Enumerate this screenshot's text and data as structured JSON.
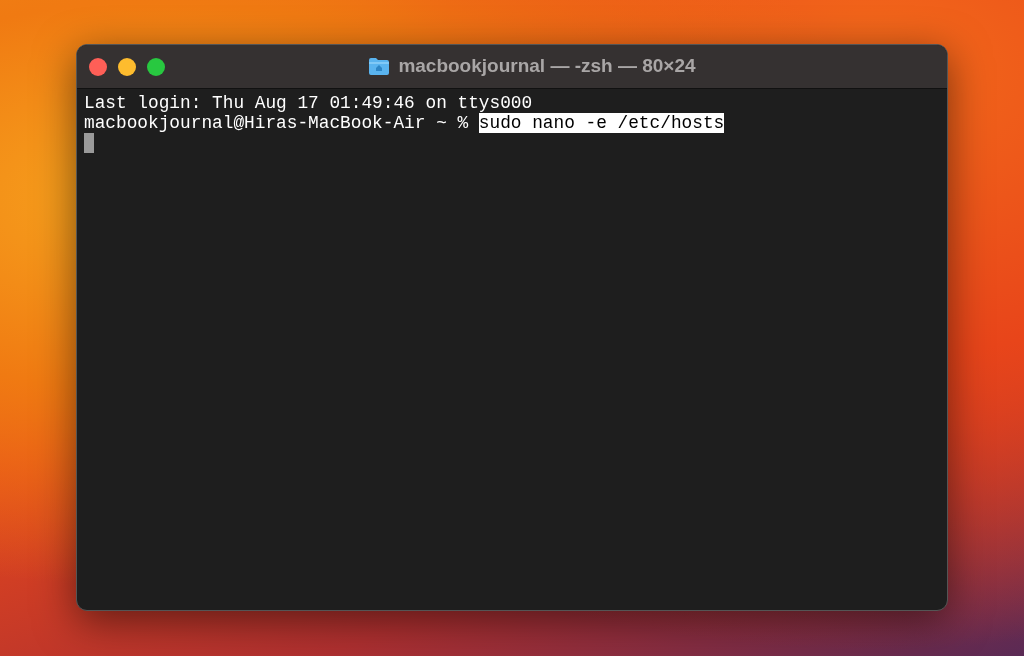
{
  "window": {
    "title": "macbookjournal — -zsh — 80×24"
  },
  "terminal": {
    "output": "Last login: Thu Aug 17 01:49:46 on ttys000",
    "prompt": "macbookjournal@Hiras-MacBook-Air ~ % ",
    "command": "sudo nano -e /etc/hosts",
    "command_selected": true
  }
}
